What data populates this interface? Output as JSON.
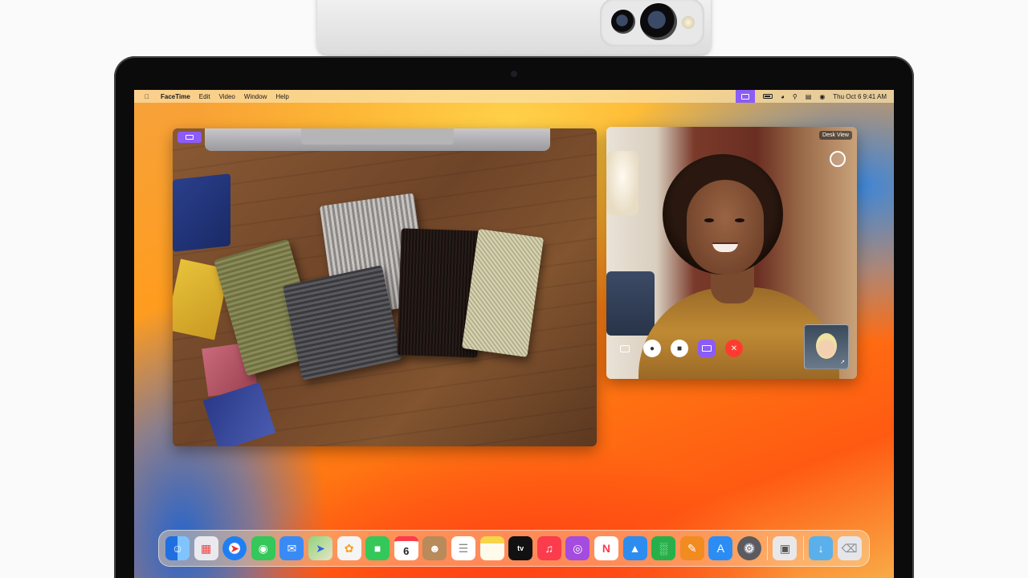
{
  "menubar": {
    "app_name": "FaceTime",
    "menus": [
      "Edit",
      "Video",
      "Window",
      "Help"
    ],
    "status_icons": [
      "desk-view-icon",
      "battery-icon",
      "wifi-icon",
      "search-icon",
      "control-center-icon",
      "siri-icon"
    ],
    "clock": "Thu Oct 6  9:41 AM"
  },
  "facetime": {
    "desk_view_label": "Desk View"
  },
  "dock": {
    "apps": [
      {
        "name": "finder-icon",
        "color": "#2a8cf0"
      },
      {
        "name": "launchpad-icon",
        "color": "#e9e9ee"
      },
      {
        "name": "safari-icon",
        "color": "#1f7ff2"
      },
      {
        "name": "messages-icon",
        "color": "#34c759"
      },
      {
        "name": "mail-icon",
        "color": "#3a8af5"
      },
      {
        "name": "maps-icon",
        "color": "#6cc46a"
      },
      {
        "name": "photos-icon",
        "color": "#f5f5f5"
      },
      {
        "name": "facetime-icon",
        "color": "#34c759"
      },
      {
        "name": "calendar-icon",
        "color": "#ffffff"
      },
      {
        "name": "contacts-icon",
        "color": "#b98a5a"
      },
      {
        "name": "reminders-icon",
        "color": "#ffffff"
      },
      {
        "name": "notes-icon",
        "color": "#f7d54a"
      },
      {
        "name": "tv-icon",
        "color": "#111111"
      },
      {
        "name": "music-icon",
        "color": "#fa3c4c"
      },
      {
        "name": "podcasts-icon",
        "color": "#a44be0"
      },
      {
        "name": "news-icon",
        "color": "#ffffff"
      },
      {
        "name": "keynote-icon",
        "color": "#2d8cf0"
      },
      {
        "name": "numbers-icon",
        "color": "#27b04a"
      },
      {
        "name": "pages-icon",
        "color": "#f28b20"
      },
      {
        "name": "app-store-icon",
        "color": "#2b8df4"
      },
      {
        "name": "system-settings-icon",
        "color": "#7a7a80"
      },
      {
        "name": "preview-icon",
        "color": "#e8e8ea"
      },
      {
        "name": "downloads-folder-icon",
        "color": "#5ab0ea"
      },
      {
        "name": "trash-icon",
        "color": "#e4e6ea"
      }
    ],
    "calendar_day": "6",
    "tv_label": "tv"
  }
}
